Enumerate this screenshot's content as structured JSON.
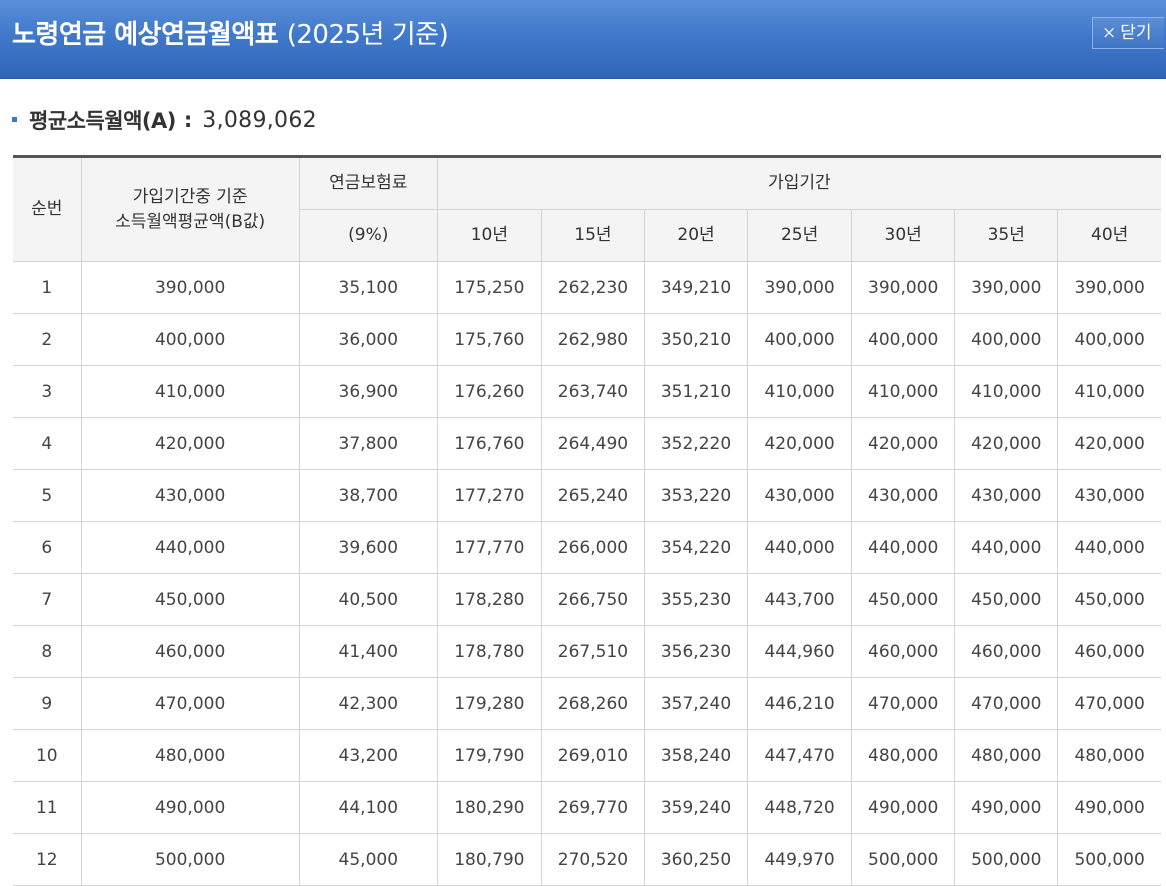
{
  "window": {
    "title": "노령연금 예상연금월액표",
    "title_year": "(2025년 기준)",
    "close_label": "닫기",
    "close_icon": "×"
  },
  "summary": {
    "label": "평균소득월액(A)",
    "colon": ":",
    "value": "3,089,062"
  },
  "table": {
    "headers": {
      "no": "순번",
      "income_line1": "가입기간중 기준",
      "income_line2": "소득월액평균액(B값)",
      "premium_line1": "연금보험료",
      "premium_line2": "(9%)",
      "period": "가입기간",
      "years": [
        "10년",
        "15년",
        "20년",
        "25년",
        "30년",
        "35년",
        "40년"
      ]
    },
    "rows": [
      [
        "1",
        "390,000",
        "35,100",
        "175,250",
        "262,230",
        "349,210",
        "390,000",
        "390,000",
        "390,000",
        "390,000"
      ],
      [
        "2",
        "400,000",
        "36,000",
        "175,760",
        "262,980",
        "350,210",
        "400,000",
        "400,000",
        "400,000",
        "400,000"
      ],
      [
        "3",
        "410,000",
        "36,900",
        "176,260",
        "263,740",
        "351,210",
        "410,000",
        "410,000",
        "410,000",
        "410,000"
      ],
      [
        "4",
        "420,000",
        "37,800",
        "176,760",
        "264,490",
        "352,220",
        "420,000",
        "420,000",
        "420,000",
        "420,000"
      ],
      [
        "5",
        "430,000",
        "38,700",
        "177,270",
        "265,240",
        "353,220",
        "430,000",
        "430,000",
        "430,000",
        "430,000"
      ],
      [
        "6",
        "440,000",
        "39,600",
        "177,770",
        "266,000",
        "354,220",
        "440,000",
        "440,000",
        "440,000",
        "440,000"
      ],
      [
        "7",
        "450,000",
        "40,500",
        "178,280",
        "266,750",
        "355,230",
        "443,700",
        "450,000",
        "450,000",
        "450,000"
      ],
      [
        "8",
        "460,000",
        "41,400",
        "178,780",
        "267,510",
        "356,230",
        "444,960",
        "460,000",
        "460,000",
        "460,000"
      ],
      [
        "9",
        "470,000",
        "42,300",
        "179,280",
        "268,260",
        "357,240",
        "446,210",
        "470,000",
        "470,000",
        "470,000"
      ],
      [
        "10",
        "480,000",
        "43,200",
        "179,790",
        "269,010",
        "358,240",
        "447,470",
        "480,000",
        "480,000",
        "480,000"
      ],
      [
        "11",
        "490,000",
        "44,100",
        "180,290",
        "269,770",
        "359,240",
        "448,720",
        "490,000",
        "490,000",
        "490,000"
      ],
      [
        "12",
        "500,000",
        "45,000",
        "180,790",
        "270,520",
        "360,250",
        "449,970",
        "500,000",
        "500,000",
        "500,000"
      ]
    ]
  }
}
